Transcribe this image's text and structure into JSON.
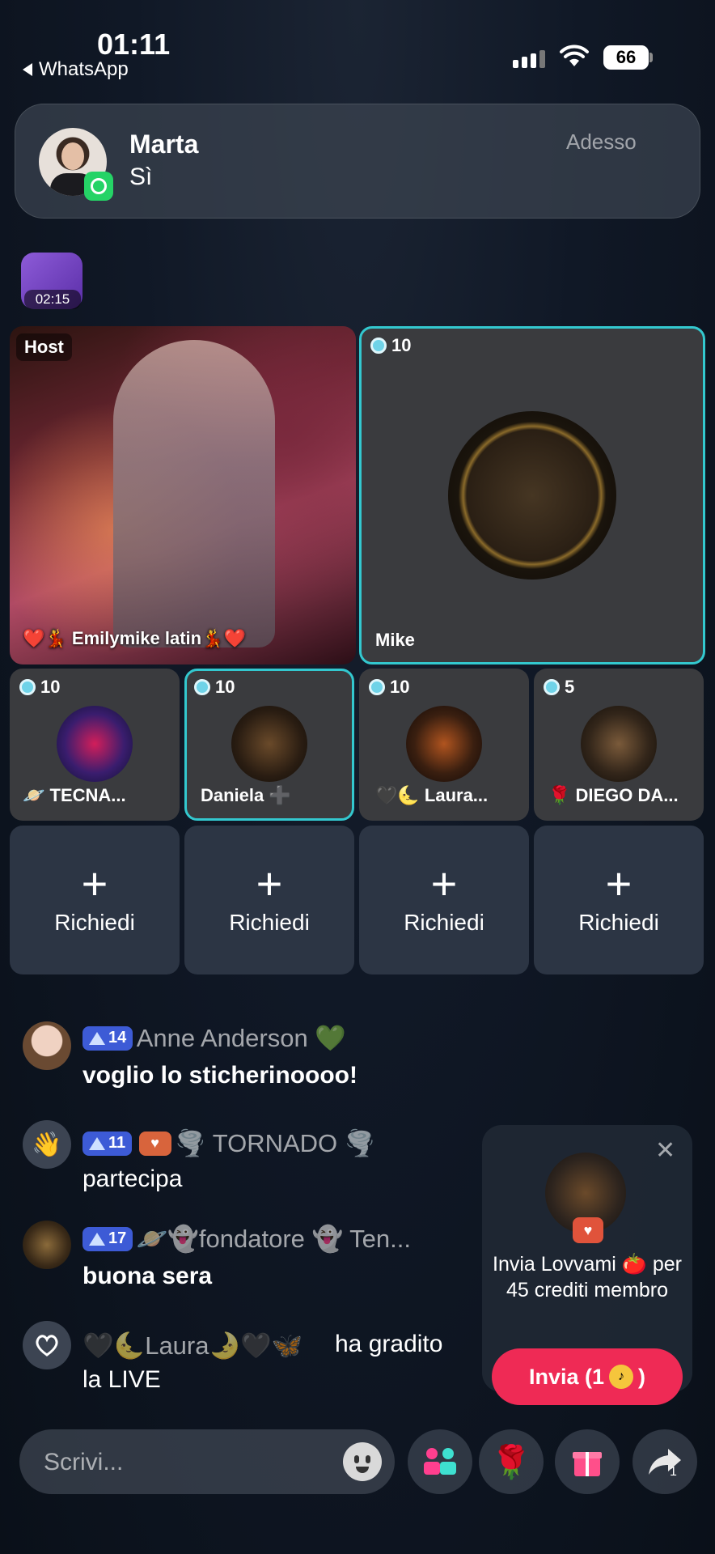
{
  "status_bar": {
    "time": "01:11",
    "back_app": "WhatsApp",
    "battery": "66"
  },
  "notification": {
    "sender": "Marta",
    "message": "Sì",
    "time": "Adesso",
    "app_icon": "whatsapp-icon"
  },
  "timer": "02:15",
  "host": {
    "label": "Host",
    "name": "❤️💃 Emilymike latin💃❤️"
  },
  "guest_main": {
    "name": "Mike",
    "score": "10"
  },
  "guests": [
    {
      "name": "🪐 TECNA...",
      "score": "10"
    },
    {
      "name": "Daniela ➕",
      "score": "10"
    },
    {
      "name": "🖤🌜 Laura...",
      "score": "10"
    },
    {
      "name": "🌹 DIEGO DA...",
      "score": "5"
    }
  ],
  "request_slots": [
    "Richiedi",
    "Richiedi",
    "Richiedi",
    "Richiedi"
  ],
  "chat": [
    {
      "level": "14",
      "name": "Anne Anderson 💚",
      "message": "voglio lo sticherinoooo!"
    },
    {
      "level": "11",
      "name": "🌪️ TORNADO 🌪️",
      "message": "partecipa"
    },
    {
      "level": "17",
      "name": "🪐👻fondatore 👻 Ten...",
      "message": "buona sera"
    },
    {
      "name": "🖤🌜Laura🌛🖤🦋",
      "message_inline": "ha gradito",
      "message": "la LIVE"
    }
  ],
  "gift_popup": {
    "text": "Invia Lovvami 🍅 per 45 crediti membro",
    "button": "Invia (1",
    "button_suffix": ")"
  },
  "bottom_bar": {
    "input_placeholder": "Scrivi...",
    "share_count": "1"
  },
  "colors": {
    "accent": "#33c8cf",
    "primary_button": "#ef2a55",
    "level_badge": "#3d5bd6"
  }
}
